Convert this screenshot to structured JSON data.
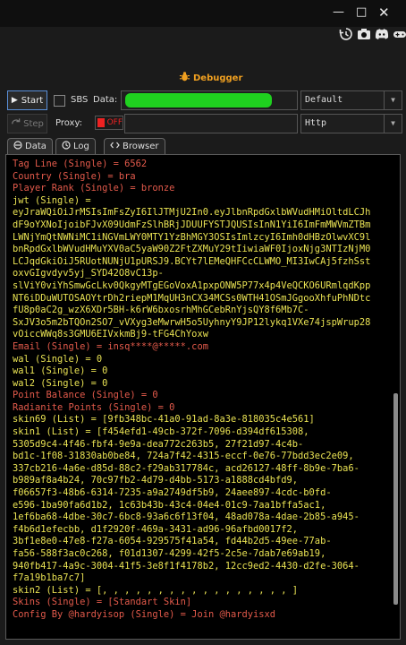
{
  "window": {
    "controls": {
      "minimize": "—",
      "maximize": "□",
      "close": "✕"
    },
    "toolbar_icons": [
      "history-icon",
      "camera-icon",
      "discord-icon",
      "game-icon"
    ],
    "panel_title": "Debugger"
  },
  "controls": {
    "start_label": "Start",
    "sbs_label": "SBS",
    "data_label": "Data:",
    "data_value": "",
    "mode_select": "Default",
    "step_label": "Step",
    "proxy_label": "Proxy:",
    "proxy_toggle": "OFF",
    "proxy_value": "",
    "protocol_select": "Http"
  },
  "tabs": [
    {
      "label": "Data",
      "active": true
    },
    {
      "label": "Log",
      "active": false
    },
    {
      "label": "Browser",
      "active": false
    }
  ],
  "colors": {
    "red": "#e35a4b",
    "yellow": "#e9e253",
    "accent": "#f0a020"
  },
  "log_lines": [
    {
      "text": "Tag Line (Single) = 6562",
      "color": "red"
    },
    {
      "text": "Country (Single) = bra",
      "color": "red"
    },
    {
      "text": "Player Rank (Single) = bronze",
      "color": "red"
    },
    {
      "text": "jwt (Single) =",
      "color": "yellow"
    },
    {
      "text": "eyJraWQiOiJrMSIsImFsZyI6IlJTMjU2In0.eyJlbnRpdGxlbWVudHMiOltdLCJh",
      "color": "yellow"
    },
    {
      "text": "dF9oYXNoIjoibFJvX09UdmFzSlhBRjJDUUFYSTJQUSIsInN1YiI6ImFmMWVmZTBm",
      "color": "yellow"
    },
    {
      "text": "LWNjYmQtNWNiMC1iNGVmLWY0MTY1YzBhMGY3OSIsImlzcyI6Imh0dHBzOlwvXC9l",
      "color": "yellow"
    },
    {
      "text": "bnRpdGxlbWVudHMuYXV0aC5yaW90Z2FtZXMuY29tIiwiaWF0IjoxNjg3NTIzNjM0",
      "color": "yellow"
    },
    {
      "text": "LCJqdGkiOiJ5RUotNUNjU1pURSJ9.BCYt7lEMeQHFCcCLWMO_MI3IwCAj5fzhSst",
      "color": "yellow"
    },
    {
      "text": "oxvGIgvdyv5yj_SYD42O8vC13p-",
      "color": "yellow"
    },
    {
      "text": "slViY0viYhSmwGcLkv0QkgyMTgEGoVoxA1pxpONW5P77x4p4VeQCKO6URmlqdKpp",
      "color": "yellow"
    },
    {
      "text": "NT6iDDuWUTOSAOYtrDh2riepM1MqUH3nCX34MCSs0WTH41OSmJGgooXhfuPhNDtc",
      "color": "yellow"
    },
    {
      "text": "fU8p0aC2g_wzX6XDr5BH-k6rW6bxosrhMhGCebRnYjsQY8f6Mb7C-",
      "color": "yellow"
    },
    {
      "text": "SxJV3o5m2bTQOn2SO7_vVXyg3eMwrwH5o5UyhnyY9JP12lykq1VXe74jspWrup28",
      "color": "yellow"
    },
    {
      "text": "vOiccWWq8s3GMU6EIVxkmBj9-tFG4ChYoxw",
      "color": "yellow"
    },
    {
      "text": "Email (Single) = insq****@*****.com",
      "color": "red"
    },
    {
      "text": "wal (Single) = 0",
      "color": "yellow"
    },
    {
      "text": "wal1 (Single) = 0",
      "color": "yellow"
    },
    {
      "text": "wal2 (Single) = 0",
      "color": "yellow"
    },
    {
      "text": "Point Balance (Single) = 0",
      "color": "red"
    },
    {
      "text": "Radianite Points (Single) = 0",
      "color": "red"
    },
    {
      "text": "skin69 (List) = [9fb348bc-41a0-91ad-8a3e-818035c4e561]",
      "color": "yellow"
    },
    {
      "text": "skin1 (List) = [f454efd1-49cb-372f-7096-d394df615308,",
      "color": "yellow"
    },
    {
      "text": "5305d9c4-4f46-fbf4-9e9a-dea772c263b5, 27f21d97-4c4b-",
      "color": "yellow"
    },
    {
      "text": "bd1c-1f08-31830ab0be84, 724a7f42-4315-eccf-0e76-77bdd3ec2e09,",
      "color": "yellow"
    },
    {
      "text": "337cb216-4a6e-d85d-88c2-f29ab317784c, acd26127-48ff-8b9e-7ba6-",
      "color": "yellow"
    },
    {
      "text": "b989af8a4b24, 70c97fb2-4d79-d4bb-5173-a1888cd4bfd9,",
      "color": "yellow"
    },
    {
      "text": "f06657f3-48b6-6314-7235-a9a2749df5b9, 24aee897-4cdc-b0fd-",
      "color": "yellow"
    },
    {
      "text": "e596-1ba90fa6d1b2, 1c63b43b-43c4-04e4-01c9-7aa1bffa5ac1,",
      "color": "yellow"
    },
    {
      "text": "1ef6ba68-4dbe-30c7-6bc8-93a6c6f13f04, 48ad078a-4dae-2b85-a945-",
      "color": "yellow"
    },
    {
      "text": "f4b6d1efecbb, d1f2920f-469a-3431-ad96-96afbd0017f2,",
      "color": "yellow"
    },
    {
      "text": "3bf1e8e0-47e8-f27a-6054-929575f41a54, fd44b2d5-49ee-77ab-",
      "color": "yellow"
    },
    {
      "text": "fa56-588f3ac0c268, f01d1307-4299-42f5-2c5e-7dab7e69ab19,",
      "color": "yellow"
    },
    {
      "text": "940fb417-4a9c-3004-41f5-3e8f1f4178b2, 12cc9ed2-4430-d2fe-3064-",
      "color": "yellow"
    },
    {
      "text": "f7a19b1ba7c7]",
      "color": "yellow"
    },
    {
      "text": "skin2 (List) = [, , , , , , , , , , , , , , , , , ]",
      "color": "yellow"
    },
    {
      "text": "Skins (Single) = [Standart Skin]",
      "color": "red"
    },
    {
      "text": "Config By @hardyisop (Single) = Join @hardyisxd",
      "color": "red"
    }
  ]
}
